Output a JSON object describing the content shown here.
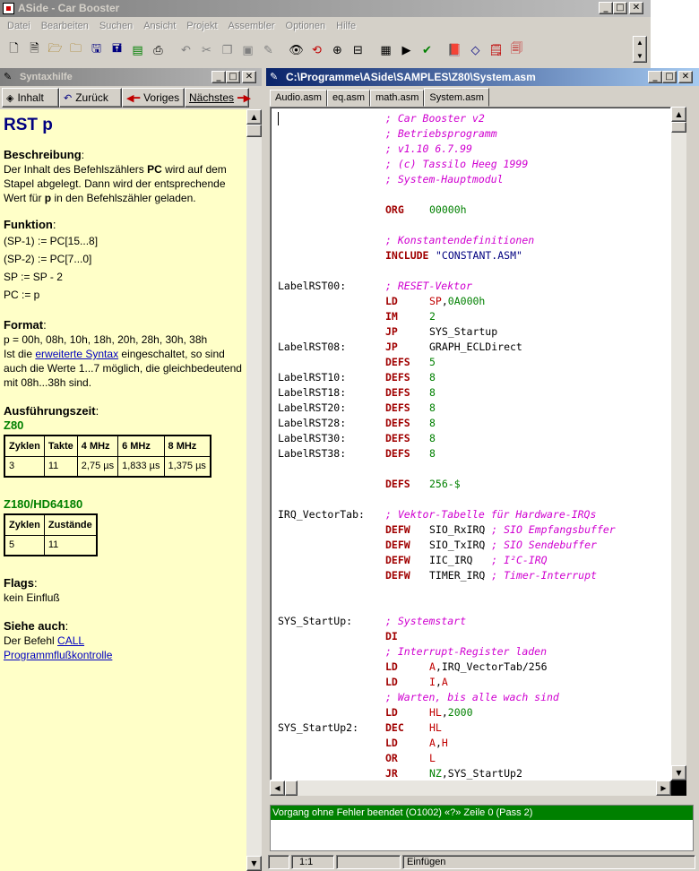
{
  "app": {
    "title": "ASide - Car Booster"
  },
  "menu": [
    "Datei",
    "Bearbeiten",
    "Suchen",
    "Ansicht",
    "Projekt",
    "Assembler",
    "Optionen",
    "Hilfe"
  ],
  "toolbar": {
    "icons": [
      "new-file-icon",
      "new-document-icon",
      "open-folder-icon",
      "open-project-icon",
      "save-icon",
      "save-all-icon",
      "close-file-icon",
      "print-icon",
      "undo-icon",
      "cut-icon",
      "copy-icon",
      "paste-icon",
      "find-icon",
      "replace-icon",
      "goto-icon",
      "compile-icon",
      "run-icon",
      "check-icon",
      "book-icon",
      "help-icon",
      "notes-icon",
      "tools-icon"
    ]
  },
  "help_panel": {
    "title": "Syntaxhilfe",
    "nav": {
      "contents": "Inhalt",
      "back": "Zurück",
      "prev": "Voriges",
      "next": "Nächstes"
    },
    "heading": "RST p",
    "desc_title": "Beschreibung",
    "desc_1": "Der Inhalt des Befehlszählers ",
    "desc_pc": "PC",
    "desc_2": " wird auf dem Stapel abgelegt. Dann wird der entsprechende Wert für ",
    "desc_p": "p",
    "desc_3": " in den Befehlszähler geladen.",
    "func_title": "Funktion",
    "func_lines": [
      "(SP-1) := PC[15...8]",
      "(SP-2) := PC[7...0]",
      "SP := SP - 2",
      "PC := p"
    ],
    "format_title": "Format",
    "format_line": "p = 00h, 08h, 10h, 18h, 20h, 28h, 30h, 38h",
    "format_2a": "Ist die ",
    "format_link": "erweiterte Syntax",
    "format_2b": " eingeschaltet, so sind auch die Werte 1...7 möglich, die gleichbedeutend mit 08h...38h sind.",
    "exec_title": "Ausführungszeit",
    "z80_label": "Z80",
    "z80_table": {
      "headers": [
        "Zyklen",
        "Takte",
        "4 MHz",
        "6 MHz",
        "8 MHz"
      ],
      "row": [
        "3",
        "11",
        "2,75 µs",
        "1,833 µs",
        "1,375 µs"
      ]
    },
    "z180_label": "Z180/HD64180",
    "z180_table": {
      "headers": [
        "Zyklen",
        "Zustände"
      ],
      "row": [
        "5",
        "11"
      ]
    },
    "flags_title": "Flags",
    "flags_text": "kein Einfluß",
    "see_title": "Siehe auch",
    "see_prefix": "Der Befehl ",
    "see_link1": "CALL",
    "see_link2": "Programmflußkontrolle"
  },
  "editor": {
    "title": "C:\\Programme\\ASide\\SAMPLES\\Z80\\System.asm",
    "tabs": [
      "Audio.asm",
      "eq.asm",
      "math.asm",
      "System.asm"
    ],
    "active_tab": "System.asm",
    "output_message": "Vorgang ohne Fehler beendet (O1002) «?» Zeile 0 (Pass 2)",
    "status": {
      "position": "1:1",
      "mode": "Einfügen"
    }
  },
  "code_lines": [
    {
      "c": "; Car Booster v2"
    },
    {
      "c": "; Betriebsprogramm"
    },
    {
      "c": "; v1.10 6.7.99"
    },
    {
      "c": "; (c) Tassilo Heeg 1999"
    },
    {
      "c": "; System-Hauptmodul"
    },
    {},
    {
      "k": "ORG",
      "o": [
        [
          "n",
          "00000h"
        ]
      ]
    },
    {},
    {
      "c": "; Konstantendefinitionen"
    },
    {
      "k": "INCLUDE",
      "o": [
        [
          "s",
          "\"CONSTANT.ASM\""
        ]
      ],
      "wide": true
    },
    {},
    {
      "l": "LabelRST00:",
      "c": "; RESET-Vektor"
    },
    {
      "k": "LD",
      "o": [
        [
          "r",
          "SP"
        ],
        [
          "t",
          ","
        ],
        [
          "n",
          "0A000h"
        ]
      ]
    },
    {
      "k": "IM",
      "o": [
        [
          "n",
          "2"
        ]
      ]
    },
    {
      "k": "JP",
      "o": [
        [
          "t",
          "SYS_Startup"
        ]
      ]
    },
    {
      "l": "LabelRST08:",
      "k": "JP",
      "o": [
        [
          "t",
          "GRAPH_ECLDirect"
        ]
      ]
    },
    {
      "k": "DEFS",
      "o": [
        [
          "n",
          "5"
        ]
      ]
    },
    {
      "l": "LabelRST10:",
      "k": "DEFS",
      "o": [
        [
          "n",
          "8"
        ]
      ]
    },
    {
      "l": "LabelRST18:",
      "k": "DEFS",
      "o": [
        [
          "n",
          "8"
        ]
      ]
    },
    {
      "l": "LabelRST20:",
      "k": "DEFS",
      "o": [
        [
          "n",
          "8"
        ]
      ]
    },
    {
      "l": "LabelRST28:",
      "k": "DEFS",
      "o": [
        [
          "n",
          "8"
        ]
      ]
    },
    {
      "l": "LabelRST30:",
      "k": "DEFS",
      "o": [
        [
          "n",
          "8"
        ]
      ]
    },
    {
      "l": "LabelRST38:",
      "k": "DEFS",
      "o": [
        [
          "n",
          "8"
        ]
      ]
    },
    {},
    {
      "k": "DEFS",
      "o": [
        [
          "n",
          "256-$"
        ]
      ]
    },
    {},
    {
      "l": "IRQ_VectorTab:",
      "c": "; Vektor-Tabelle für Hardware-IRQs"
    },
    {
      "k": "DEFW",
      "o": [
        [
          "t",
          "SIO_RxIRQ "
        ],
        [
          "c",
          "; SIO Empfangsbuffer"
        ]
      ]
    },
    {
      "k": "DEFW",
      "o": [
        [
          "t",
          "SIO_TxIRQ "
        ],
        [
          "c",
          "; SIO Sendebuffer"
        ]
      ]
    },
    {
      "k": "DEFW",
      "o": [
        [
          "t",
          "IIC_IRQ   "
        ],
        [
          "c",
          "; I²C-IRQ"
        ]
      ]
    },
    {
      "k": "DEFW",
      "o": [
        [
          "t",
          "TIMER_IRQ "
        ],
        [
          "c",
          "; Timer-Interrupt"
        ]
      ]
    },
    {},
    {},
    {
      "l": "SYS_StartUp:",
      "c": "; Systemstart"
    },
    {
      "k": "DI"
    },
    {
      "c": "; Interrupt-Register laden"
    },
    {
      "k": "LD",
      "o": [
        [
          "r",
          "A"
        ],
        [
          "t",
          ",IRQ_VectorTab/256"
        ]
      ]
    },
    {
      "k": "LD",
      "o": [
        [
          "r",
          "I"
        ],
        [
          "t",
          ","
        ],
        [
          "r",
          "A"
        ]
      ]
    },
    {
      "c": "; Warten, bis alle wach sind"
    },
    {
      "k": "LD",
      "o": [
        [
          "r",
          "HL"
        ],
        [
          "t",
          ","
        ],
        [
          "n",
          "2000"
        ]
      ]
    },
    {
      "l": "SYS_StartUp2:",
      "k": "DEC",
      "o": [
        [
          "r",
          "HL"
        ]
      ]
    },
    {
      "k": "LD",
      "o": [
        [
          "r",
          "A"
        ],
        [
          "t",
          ","
        ],
        [
          "r",
          "H"
        ]
      ]
    },
    {
      "k": "OR",
      "o": [
        [
          "r",
          "L"
        ]
      ]
    },
    {
      "k": "JR",
      "o": [
        [
          "n",
          "NZ"
        ],
        [
          "t",
          ",SYS_StartUp2"
        ]
      ]
    }
  ]
}
